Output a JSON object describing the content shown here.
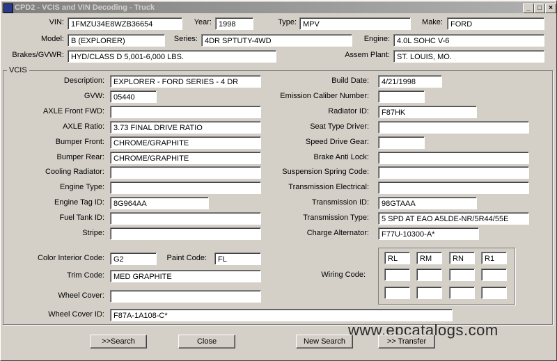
{
  "window": {
    "title": "CPD2 - VCIS and VIN Decoding - Truck",
    "min": "_",
    "max": "□",
    "close": "×"
  },
  "header": {
    "vin": {
      "label": "VIN:",
      "value": "1FMZU34E8WZB36654"
    },
    "year": {
      "label": "Year:",
      "value": "1998"
    },
    "type": {
      "label": "Type:",
      "value": "MPV"
    },
    "make": {
      "label": "Make:",
      "value": "FORD"
    },
    "model": {
      "label": "Model:",
      "value": "B (EXPLORER)"
    },
    "series": {
      "label": "Series:",
      "value": "4DR SPTUTY-4WD"
    },
    "engine": {
      "label": "Engine:",
      "value": "4.0L SOHC V-6"
    },
    "brakes": {
      "label": "Brakes/GVWR:",
      "value": "HYD/CLASS D 5,001-6,000 LBS."
    },
    "plant": {
      "label": "Assem Plant:",
      "value": "ST. LOUIS, MO."
    }
  },
  "vcis": {
    "group_label": "VCIS",
    "left": [
      {
        "label": "Description:",
        "value": "EXPLORER - FORD SERIES - 4 DR"
      },
      {
        "label": "GVW:",
        "value": "05440"
      },
      {
        "label": "AXLE Front FWD:",
        "value": ""
      },
      {
        "label": "AXLE Ratio:",
        "value": "3.73 FINAL DRIVE RATIO"
      },
      {
        "label": "Bumper Front:",
        "value": "CHROME/GRAPHITE"
      },
      {
        "label": "Bumper Rear:",
        "value": "CHROME/GRAPHITE"
      },
      {
        "label": "Cooling Radiator:",
        "value": ""
      },
      {
        "label": "Engine Type:",
        "value": ""
      },
      {
        "label": "Engine Tag ID:",
        "value": "8G964AA"
      },
      {
        "label": "Fuel Tank ID:",
        "value": ""
      },
      {
        "label": "Stripe:",
        "value": ""
      }
    ],
    "right": [
      {
        "label": "Build Date:",
        "value": "4/21/1998"
      },
      {
        "label": "Emission Caliber Number:",
        "value": ""
      },
      {
        "label": "Radiator ID:",
        "value": "F87HK"
      },
      {
        "label": "Seat Type Driver:",
        "value": ""
      },
      {
        "label": "Speed Drive Gear:",
        "value": ""
      },
      {
        "label": "Brake Anti Lock:",
        "value": ""
      },
      {
        "label": "Suspension Spring Code:",
        "value": ""
      },
      {
        "label": "Transmission Electrical:",
        "value": ""
      },
      {
        "label": "Transmission ID:",
        "value": "98GTAAA"
      },
      {
        "label": "Transmission Type:",
        "value": "5 SPD AT EAO A5LDE-NR/5R44/55E"
      },
      {
        "label": "Charge Alternator:",
        "value": "F77U-10300-A*"
      }
    ],
    "color_interior": {
      "label": "Color Interior Code:",
      "value": "G2"
    },
    "paint_code": {
      "label": "Paint Code:",
      "value": "FL"
    },
    "trim_code": {
      "label": "Trim Code:",
      "value": "MED GRAPHITE"
    },
    "wheel_cover": {
      "label": "Wheel Cover:",
      "value": ""
    },
    "wheel_cover_id": {
      "label": "Wheel Cover ID:",
      "value": "F87A-1A108-C*"
    },
    "wiring": {
      "label": "Wiring Code:",
      "values": [
        "RL",
        "RM",
        "RN",
        "R1",
        "",
        "",
        "",
        "",
        "",
        "",
        "",
        ""
      ]
    }
  },
  "buttons": {
    "search": ">>Search",
    "close": "Close",
    "new_search": "New Search",
    "transfer": ">> Transfer"
  },
  "watermark": "www.epcatalogs.com"
}
